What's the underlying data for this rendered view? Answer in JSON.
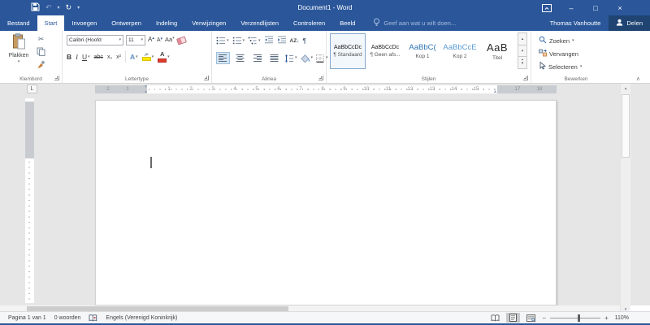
{
  "titlebar": {
    "title": "Document1 - Word"
  },
  "tabs": [
    {
      "label": "Bestand"
    },
    {
      "label": "Start"
    },
    {
      "label": "Invoegen"
    },
    {
      "label": "Ontwerpen"
    },
    {
      "label": "Indeling"
    },
    {
      "label": "Verwijzingen"
    },
    {
      "label": "Verzendlijsten"
    },
    {
      "label": "Controleren"
    },
    {
      "label": "Beeld"
    }
  ],
  "tellme": {
    "placeholder": "Geef aan wat u wilt doen..."
  },
  "account": {
    "name": "Thomas Vanhoutte"
  },
  "share": {
    "label": "Delen"
  },
  "ribbon": {
    "klembord": {
      "label": "Klembord",
      "paste_label": "Plakken"
    },
    "lettertype": {
      "label": "Lettertype",
      "font_name": "Calibri (Hoofd",
      "font_size": "11",
      "grow_font": "A",
      "shrink_font": "A",
      "change_case": "Aa",
      "bold": "B",
      "italic": "I",
      "underline": "U",
      "strikethrough": "abc",
      "subscript": "x₂",
      "superscript": "x²",
      "text_effects": "A",
      "highlight_letters": "",
      "font_color": "A"
    },
    "alinea": {
      "label": "Alinea",
      "sort_letters": "AZ",
      "sort_arrow": "↓",
      "pilcrow": "¶"
    },
    "stijlen": {
      "label": "Stijlen",
      "styles": [
        {
          "preview": "AaBbCcDc",
          "name": "¶ Standaard"
        },
        {
          "preview": "AaBbCcDc",
          "name": "¶ Geen afs..."
        },
        {
          "preview": "AaBbC(",
          "name": "Kop 1"
        },
        {
          "preview": "AaBbCcE",
          "name": "Kop 2"
        },
        {
          "preview": "AaB",
          "name": "Titel"
        }
      ]
    },
    "bewerken": {
      "label": "Bewerken",
      "find": "Zoeken",
      "replace": "Vervangen",
      "select": "Selecteren"
    }
  },
  "ruler": {
    "left_numbers": [
      "2",
      "1"
    ],
    "main_numbers": [
      "1",
      "2",
      "3",
      "4",
      "5",
      "6",
      "7",
      "8",
      "9",
      "10",
      "11",
      "12",
      "13",
      "14",
      "15"
    ],
    "right_numbers": [
      "17",
      "18"
    ]
  },
  "statusbar": {
    "page": "Pagina 1 van 1",
    "words": "0 woorden",
    "language": "Engels (Verenigd Koninkrijk)",
    "zoom_out": "−",
    "zoom_in": "+",
    "zoom_level": "110%"
  },
  "icons": {
    "undo": "↶",
    "redo": "↻",
    "minimize": "–",
    "maximize": "□",
    "close": "×",
    "dropdown": "▾",
    "up": "▴",
    "down": "▾",
    "scissors": "✂",
    "collapse_ribbon": "∧",
    "tab_stop": "L",
    "first_line_indent": "▾",
    "hanging_indent": "▴",
    "right_indent": "▴"
  },
  "colors": {
    "accent": "#2b579a",
    "share_background": "#1f4472",
    "heading1_text": "#2e74b5",
    "heading2_text": "#5b9bd5",
    "highlight_yellow": "#ffe600",
    "font_color_red": "#e23b2e"
  }
}
